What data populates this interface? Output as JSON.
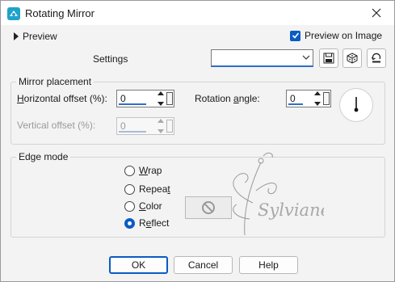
{
  "window": {
    "title": "Rotating Mirror"
  },
  "preview": {
    "toggle_label": "Preview",
    "checkbox_label": "Preview on Image",
    "checked": true
  },
  "settings": {
    "label": "Settings",
    "value": ""
  },
  "mirror": {
    "group_label": "Mirror placement",
    "horizontal_offset": {
      "prefix": "H",
      "rest": "orizontal offset (%):",
      "value": "0"
    },
    "vertical_offset": {
      "label": "Vertical offset (%):",
      "value": "0",
      "enabled": false
    },
    "rotation_angle": {
      "label_a": "Rotation ",
      "label_ul": "a",
      "label_b": "ngle:",
      "value": "0"
    }
  },
  "edge": {
    "group_label": "Edge mode",
    "options": [
      {
        "pre": "",
        "ul": "W",
        "post": "rap",
        "selected": false
      },
      {
        "pre": "Repea",
        "ul": "t",
        "post": "",
        "selected": false
      },
      {
        "pre": "",
        "ul": "C",
        "post": "olor",
        "selected": false
      },
      {
        "pre": "R",
        "ul": "e",
        "post": "flect",
        "selected": true
      }
    ]
  },
  "watermark_text": "Sylviane",
  "buttons": {
    "ok": "OK",
    "cancel": "Cancel",
    "help": "Help"
  },
  "colors": {
    "accent": "#0a5bc4",
    "app_icon": "#1fa3c9"
  }
}
